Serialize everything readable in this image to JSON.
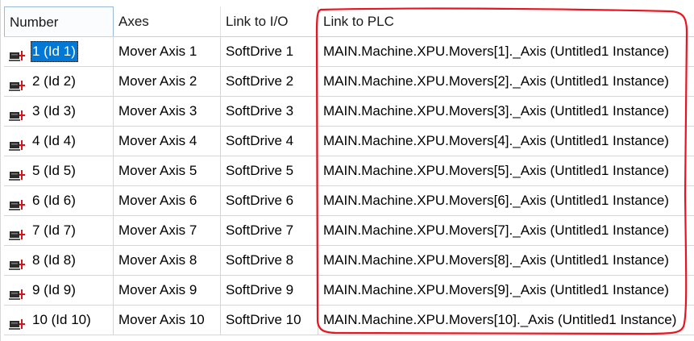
{
  "table": {
    "columns": [
      "Number",
      "Axes",
      "Link to I/O",
      "Link to PLC"
    ],
    "rows": [
      {
        "number": "1 (Id 1)",
        "axis": "Mover Axis 1",
        "io": "SoftDrive 1",
        "plc": "MAIN.Machine.XPU.Movers[1]._Axis (Untitled1 Instance)",
        "selected": true
      },
      {
        "number": "2 (Id 2)",
        "axis": "Mover Axis 2",
        "io": "SoftDrive 2",
        "plc": "MAIN.Machine.XPU.Movers[2]._Axis (Untitled1 Instance)"
      },
      {
        "number": "3 (Id 3)",
        "axis": "Mover Axis 3",
        "io": "SoftDrive 3",
        "plc": "MAIN.Machine.XPU.Movers[3]._Axis (Untitled1 Instance)"
      },
      {
        "number": "4 (Id 4)",
        "axis": "Mover Axis 4",
        "io": "SoftDrive 4",
        "plc": "MAIN.Machine.XPU.Movers[4]._Axis (Untitled1 Instance)"
      },
      {
        "number": "5 (Id 5)",
        "axis": "Mover Axis 5",
        "io": "SoftDrive 5",
        "plc": "MAIN.Machine.XPU.Movers[5]._Axis (Untitled1 Instance)"
      },
      {
        "number": "6 (Id 6)",
        "axis": "Mover Axis 6",
        "io": "SoftDrive 6",
        "plc": "MAIN.Machine.XPU.Movers[6]._Axis (Untitled1 Instance)"
      },
      {
        "number": "7 (Id 7)",
        "axis": "Mover Axis 7",
        "io": "SoftDrive 7",
        "plc": "MAIN.Machine.XPU.Movers[7]._Axis (Untitled1 Instance)"
      },
      {
        "number": "8 (Id 8)",
        "axis": "Mover Axis 8",
        "io": "SoftDrive 8",
        "plc": "MAIN.Machine.XPU.Movers[8]._Axis (Untitled1 Instance)"
      },
      {
        "number": "9 (Id 9)",
        "axis": "Mover Axis 9",
        "io": "SoftDrive 9",
        "plc": "MAIN.Machine.XPU.Movers[9]._Axis (Untitled1 Instance)"
      },
      {
        "number": "10 (Id 10)",
        "axis": "Mover Axis 10",
        "io": "SoftDrive 10",
        "plc": "MAIN.Machine.XPU.Movers[10]._Axis (Untitled1 Instance)"
      }
    ]
  },
  "icons": {
    "row_icon": "axis-motor-icon"
  },
  "colors": {
    "selection": "#0078d7",
    "annotation": "#e8141e",
    "icon_body": "#2b2b2b",
    "icon_accent": "#d4151c"
  }
}
